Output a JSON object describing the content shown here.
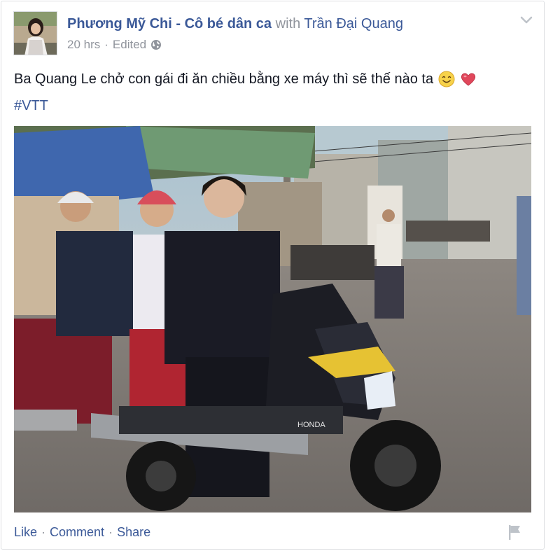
{
  "post": {
    "author": "Phương Mỹ Chi - Cô bé dân ca",
    "with_word": "with",
    "tagged": "Trần Đại Quang",
    "time": "20 hrs",
    "separator": "·",
    "edited": "Edited",
    "privacy_icon": "globe-icon",
    "text": "Ba Quang Le chở con gái đi ăn chiều bằng xe máy thì sẽ thế nào ta",
    "emojis": [
      "smile-emoji",
      "heart-emoji"
    ],
    "hashtag": "#VTT",
    "photo_icon": "street-motorbike-photo",
    "photo_sign": "HONDA"
  },
  "actions": {
    "like": "Like",
    "comment": "Comment",
    "share": "Share",
    "dot": "·"
  },
  "colors": {
    "link": "#3b5998",
    "muted": "#90949c",
    "text": "#141823",
    "heart": "#e0475b"
  }
}
